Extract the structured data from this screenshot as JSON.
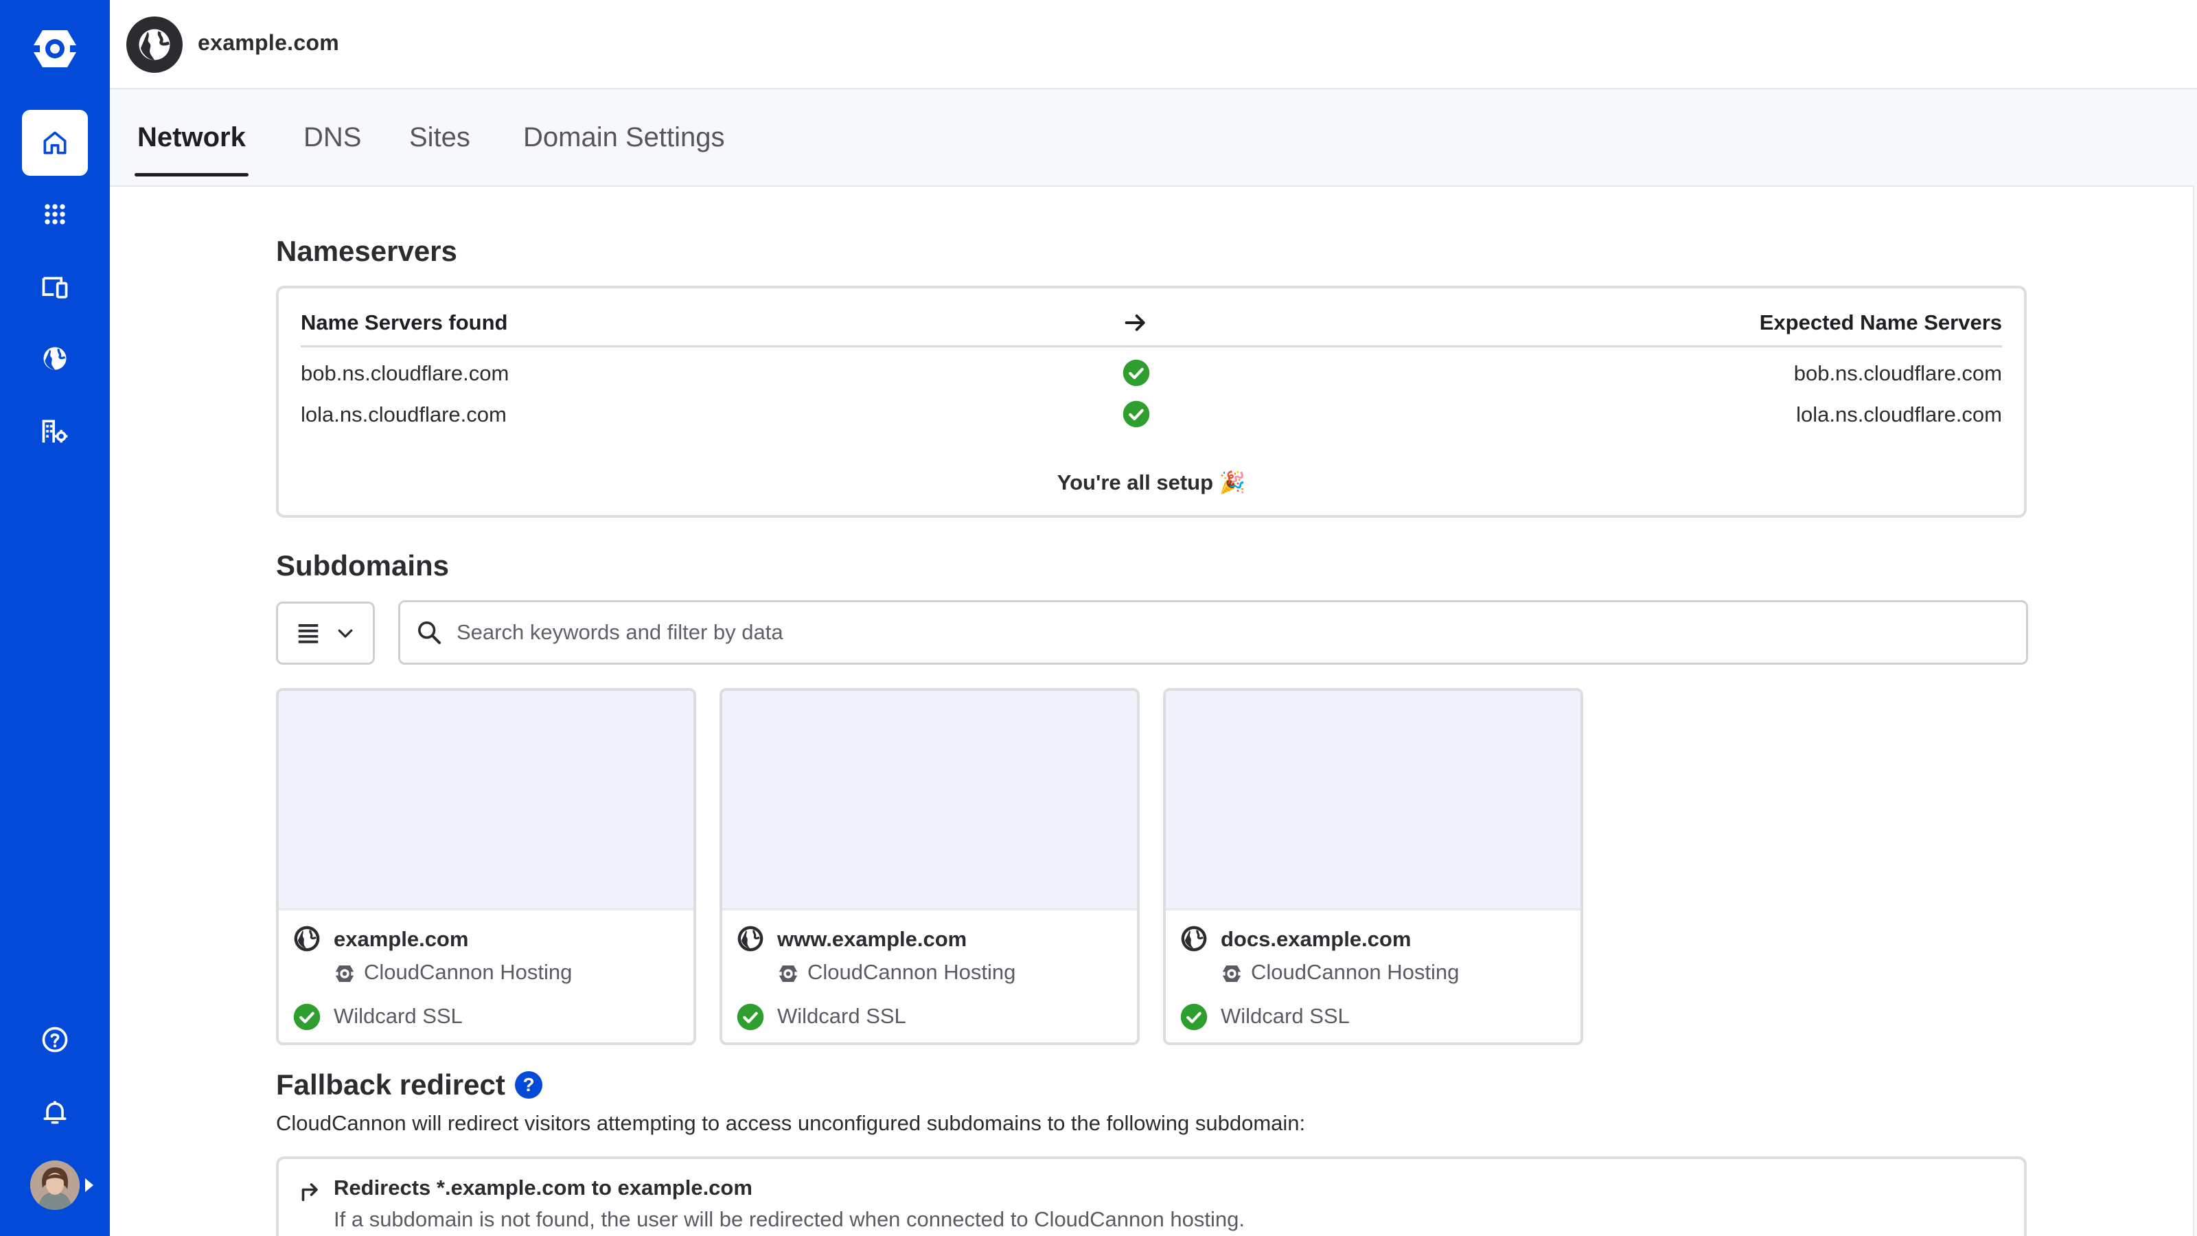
{
  "app": {
    "domain": "example.com"
  },
  "tabs": [
    {
      "label": "Network",
      "active": true
    },
    {
      "label": "DNS",
      "active": false
    },
    {
      "label": "Sites",
      "active": false
    },
    {
      "label": "Domain Settings",
      "active": false
    }
  ],
  "sidebar": {
    "items": [
      {
        "icon": "home-icon",
        "active": true
      },
      {
        "icon": "apps-grid-icon",
        "active": false
      },
      {
        "icon": "devices-icon",
        "active": false
      },
      {
        "icon": "globe-icon",
        "active": false
      },
      {
        "icon": "organization-settings-icon",
        "active": false
      }
    ],
    "bottom": [
      {
        "icon": "help-icon"
      },
      {
        "icon": "bell-icon"
      }
    ]
  },
  "nameservers": {
    "title": "Nameservers",
    "found_header": "Name Servers found",
    "expected_header": "Expected Name Servers",
    "rows": [
      {
        "found": "bob.ns.cloudflare.com",
        "expected": "bob.ns.cloudflare.com",
        "match": true
      },
      {
        "found": "lola.ns.cloudflare.com",
        "expected": "lola.ns.cloudflare.com",
        "match": true
      }
    ],
    "status": "You're all setup 🎉"
  },
  "subdomains": {
    "title": "Subdomains",
    "search_placeholder": "Search keywords and filter by data",
    "cards": [
      {
        "name": "example.com",
        "hosting": "CloudCannon Hosting",
        "ssl": "Wildcard SSL"
      },
      {
        "name": "www.example.com",
        "hosting": "CloudCannon Hosting",
        "ssl": "Wildcard SSL"
      },
      {
        "name": "docs.example.com",
        "hosting": "CloudCannon Hosting",
        "ssl": "Wildcard SSL"
      }
    ]
  },
  "fallback": {
    "title": "Fallback redirect",
    "help": "?",
    "description": "CloudCannon will redirect visitors attempting to access unconfigured subdomains to the following subdomain:",
    "redirect_title": "Redirects *.example.com to example.com",
    "redirect_desc": "If a subdomain is not found, the user will be redirected when connected to CloudCannon hosting."
  },
  "colors": {
    "sidebar": "#034ad8",
    "success": "#2e9e2e",
    "text": "#1f1f23"
  }
}
